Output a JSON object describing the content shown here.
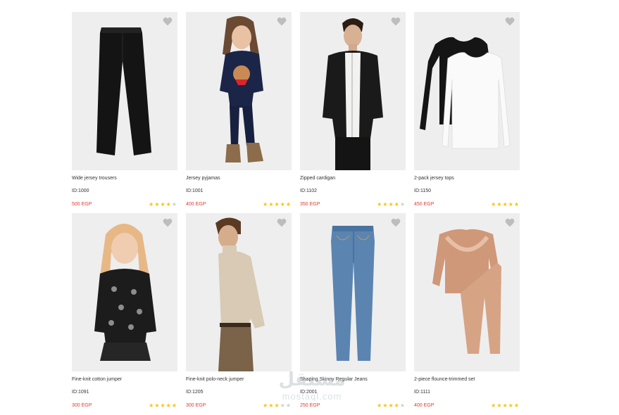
{
  "products": [
    {
      "name": "Wide jersey trousers",
      "id": "ID:1000",
      "price": "500 EGP",
      "rating": 4,
      "image": "black-wide-trousers",
      "bg": "#eeeeee"
    },
    {
      "name": "Jersey pyjamas",
      "id": "ID:1001",
      "price": "400 EGP",
      "rating": 5,
      "image": "girl-navy-pyjamas",
      "bg": "#eeeeee"
    },
    {
      "name": "Zipped cardigan",
      "id": "ID:1102",
      "price": "350 EGP",
      "rating": 4,
      "image": "man-black-cardigan",
      "bg": "#eeeeee"
    },
    {
      "name": "2-pack jersey tops",
      "id": "ID:1150",
      "price": "450 EGP",
      "rating": 5,
      "image": "black-white-tops",
      "bg": "#eeeeee"
    },
    {
      "name": "Fine-knit cotton jumper",
      "id": "ID:1091",
      "price": "300 EGP",
      "rating": 5,
      "image": "girl-black-jumper",
      "bg": "#eeeeee"
    },
    {
      "name": "Fine-knit polo-neck jumper",
      "id": "ID:1205",
      "price": "300 EGP",
      "rating": 3,
      "image": "man-beige-polo-neck",
      "bg": "#eeeeee"
    },
    {
      "name": "Shaping Skinny Regular Jeans",
      "id": "ID:2001",
      "price": "250 EGP",
      "rating": 4,
      "image": "blue-skinny-jeans",
      "bg": "#eeeeee"
    },
    {
      "name": "2-piece flounce-trimmed set",
      "id": "ID:1111",
      "price": "400 EGP",
      "rating": 5,
      "image": "pink-flounce-set",
      "bg": "#eeeeee"
    }
  ],
  "rating_max": 5,
  "icons": {
    "favorite": "heart-icon",
    "rating": "star-icon"
  },
  "colors": {
    "price": "#e53935",
    "star_on": "#ffc107",
    "star_off": "#cfcfcf",
    "card_bg": "#eeeeee"
  },
  "watermark": {
    "logo": "مستقل",
    "text": "mostaql.com"
  }
}
